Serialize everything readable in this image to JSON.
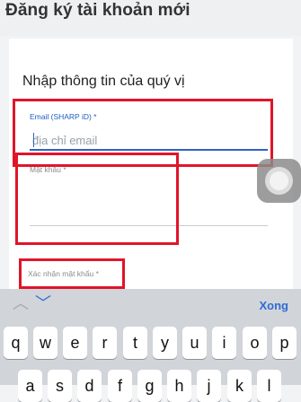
{
  "header": {
    "title": "Đăng ký tài khoản mới"
  },
  "form": {
    "section_title": "Nhập thông tin của quý vị",
    "email": {
      "label": "Email (SHARP iD) *",
      "placeholder": "địa chỉ email"
    },
    "password": {
      "label": "Mật khẩu *"
    },
    "confirm_password": {
      "label": "Xác nhận mật khẩu *"
    }
  },
  "keyboard": {
    "done_label": "Xong",
    "arrow_up": "︿",
    "arrow_down": "﹀",
    "row1": [
      "q",
      "w",
      "e",
      "r",
      "t",
      "y",
      "u",
      "i",
      "o",
      "p"
    ],
    "row2": [
      "a",
      "s",
      "d",
      "f",
      "g",
      "h",
      "j",
      "k",
      "l"
    ]
  },
  "colors": {
    "highlight": "#e0152a",
    "accent": "#2f63c2"
  },
  "icons": {
    "assistive": "assistive-touch-icon"
  }
}
